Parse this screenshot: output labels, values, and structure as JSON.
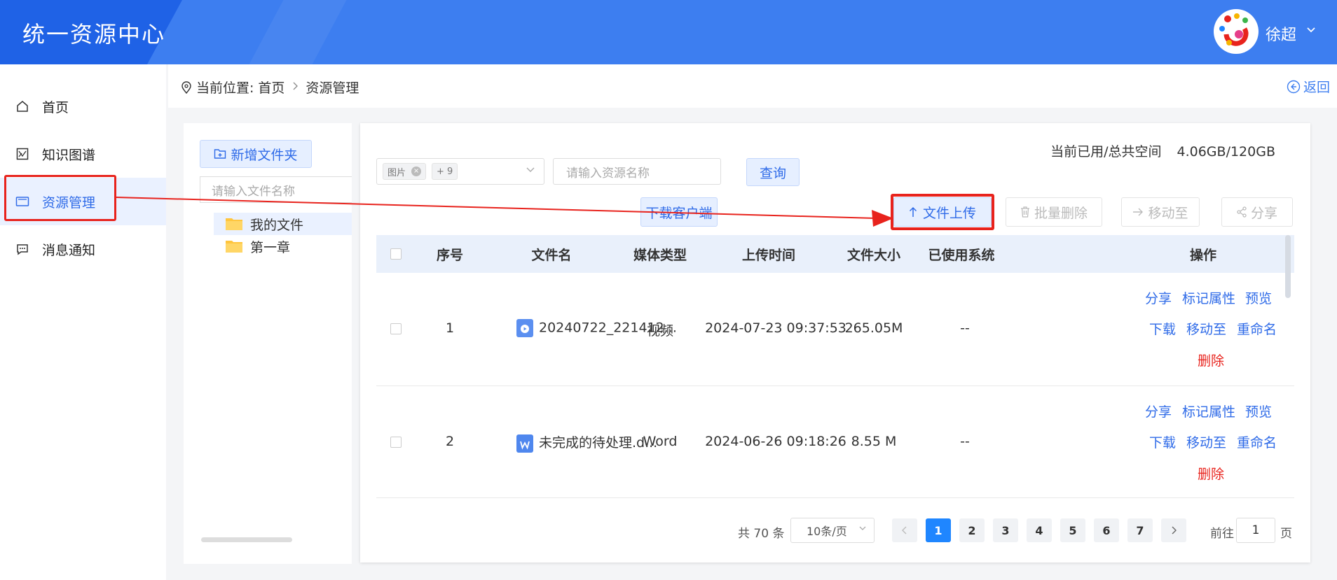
{
  "app": {
    "title": "统一资源中心"
  },
  "user": {
    "name": "徐超"
  },
  "sidebar": {
    "items": [
      {
        "label": "首页",
        "icon": "home-icon"
      },
      {
        "label": "知识图谱",
        "icon": "graph-icon"
      },
      {
        "label": "资源管理",
        "icon": "folder-open-icon",
        "active": true
      },
      {
        "label": "消息通知",
        "icon": "message-icon"
      }
    ]
  },
  "breadcrumb": {
    "prefix": "当前位置:",
    "home": "首页",
    "current": "资源管理",
    "back": "返回"
  },
  "tree": {
    "new_folder": "新增文件夹",
    "search_placeholder": "请输入文件名称",
    "nodes": [
      {
        "label": "我的文件",
        "selected": true
      },
      {
        "label": "第一章"
      }
    ]
  },
  "space": {
    "label": "当前已用/总共空间",
    "value": "4.06GB/120GB"
  },
  "filters": {
    "type_tag": "图片",
    "type_more": "+ 9",
    "name_placeholder": "请输入资源名称",
    "query": "查询"
  },
  "toolbar": {
    "download_client": "下载客户端",
    "upload": "文件上传",
    "batch_delete": "批量删除",
    "move_to": "移动至",
    "share": "分享"
  },
  "table": {
    "columns": [
      "序号",
      "文件名",
      "媒体类型",
      "上传时间",
      "文件大小",
      "已使用系统",
      "操作"
    ],
    "rows": [
      {
        "index": "1",
        "name": "20240722_221412...",
        "file_icon": "video-file-icon",
        "media": "视频",
        "time": "2024-07-23 09:37:53",
        "size": "265.05M",
        "used": "--"
      },
      {
        "index": "2",
        "name": "未完成的待处理.d...",
        "file_icon": "word-file-icon",
        "media": "Word",
        "time": "2024-06-26 09:18:26",
        "size": "8.55 M",
        "used": "--"
      }
    ],
    "ops": {
      "share": "分享",
      "mark": "标记属性",
      "preview": "预览",
      "download": "下载",
      "move": "移动至",
      "rename": "重命名",
      "delete": "删除"
    }
  },
  "pager": {
    "total": "共 70 条",
    "page_size": "10条/页",
    "pages": [
      "1",
      "2",
      "3",
      "4",
      "5",
      "6",
      "7"
    ],
    "current": "1",
    "goto_prefix": "前往",
    "goto_value": "1",
    "goto_suffix": "页"
  },
  "colors": {
    "brand": "#3d7ef0",
    "header_dark": "#1f62e6",
    "link": "#2f6be8",
    "danger": "#e8231d",
    "annotation": "#e8231d"
  }
}
